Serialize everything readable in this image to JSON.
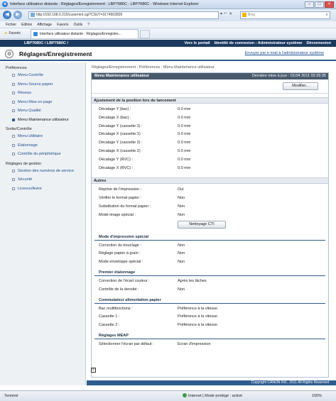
{
  "browser": {
    "window_title": "Interface utilisateur distante : Réglages/Enregistrement : LBP7680C : LBP7680C - Windows Internet Explorer",
    "address": "http://192.168.0.215/cusermnt.cgi?CSUT=3174502826",
    "search_placeholder": "Bing",
    "menu": [
      "Fichier",
      "Edition",
      "Affichage",
      "Favoris",
      "Outils",
      "?"
    ],
    "favorites_label": "Favoris",
    "tab_label": "Interface utilisateur distante : Réglages/Enregistre...",
    "status_left": "Terminé",
    "status_zone": "Internet | Mode protégé : activé",
    "zoom": "100%"
  },
  "app": {
    "model": "LBP7680C / LBP7680C /",
    "top_links": [
      "Vers le portail",
      "Identité de connexion : Administrateur système",
      "Déconnexion"
    ],
    "page_title": "Réglages/Enregistrement",
    "mail_link": "Envoyer par e-mail à l'administrateur système"
  },
  "sidebar": {
    "sections": [
      {
        "title": "Préférences",
        "items": [
          {
            "label": "Menu Contrôle",
            "active": false
          },
          {
            "label": "Menu Source papier",
            "active": false
          },
          {
            "label": "Réseau",
            "active": false
          },
          {
            "label": "Menu Mise en page",
            "active": false
          },
          {
            "label": "Menu Qualité",
            "active": false
          },
          {
            "label": "Menu Maintenance utilisateur",
            "active": true
          }
        ]
      },
      {
        "title": "Sortie/Contrôle",
        "items": [
          {
            "label": "Menu Utilitaire",
            "active": false
          },
          {
            "label": "Etalonnage",
            "active": false
          },
          {
            "label": "Contrôle du périphérique",
            "active": false
          }
        ]
      },
      {
        "title": "Réglages de gestion",
        "items": [
          {
            "label": "Gestion des numéros de service",
            "active": false
          },
          {
            "label": "Sécurité",
            "active": false
          },
          {
            "label": "Licence/Autre",
            "active": false
          }
        ]
      }
    ]
  },
  "main": {
    "breadcrumb": "Réglages/Enregistrement : Préférences : Menu Maintenance utilisateur",
    "panel_title": "Menu Maintenance utilisateur",
    "last_update": "Dernière mise à jour : 01/04 2011 02:29:35",
    "modify_button": "Modifier...",
    "group1": {
      "title": "Ajustement de la position lors du lancement",
      "rows": [
        {
          "label": "Décalage Y (bac) :",
          "value": "0.0 mm"
        },
        {
          "label": "Décalage X (bac) :",
          "value": "0.0 mm"
        },
        {
          "label": "Décalage Y (cassette 1) :",
          "value": "0.0 mm"
        },
        {
          "label": "Décalage X (cassette 1) :",
          "value": "0.0 mm"
        },
        {
          "label": "Décalage Y (cassette 2) :",
          "value": "0.0 mm"
        },
        {
          "label": "Décalage X (cassette 2) :",
          "value": "0.0 mm"
        },
        {
          "label": "Décalage Y (RVC) :",
          "value": "0.0 mm"
        },
        {
          "label": "Décalage X (RVC) :",
          "value": "0.0 mm"
        }
      ]
    },
    "group2": {
      "title": "Autres",
      "rows": [
        {
          "label": "Reprise de l'impression :",
          "value": "Oui"
        },
        {
          "label": "Vérifier le format papier :",
          "value": "Non"
        },
        {
          "label": "Substitution du format papier :",
          "value": "Non"
        },
        {
          "label": "Mode image spécial :",
          "value": "Non"
        }
      ],
      "cti_button": "Nettoyage CTI",
      "subsections": [
        {
          "title": "Mode d'impression spécial",
          "rows": [
            {
              "label": "Correction du bouclage :",
              "value": "Non"
            },
            {
              "label": "Réglage papier à grain :",
              "value": "Non"
            },
            {
              "label": "Mode enveloppe spécial :",
              "value": "Non"
            }
          ]
        },
        {
          "title": "Premier étalonnage",
          "rows": [
            {
              "label": "Correction de l'écart couleur :",
              "value": "Après les tâches"
            },
            {
              "label": "Contrôle de la densité :",
              "value": "Non"
            }
          ]
        },
        {
          "title": "Commutateur alimentation papier",
          "rows": [
            {
              "label": "Bac multifonctions :",
              "value": "Préférence à la vitesse"
            },
            {
              "label": "Cassette 1 :",
              "value": "Préférence à la vitesse"
            },
            {
              "label": "Cassette 2 :",
              "value": "Préférence à la vitesse"
            }
          ]
        },
        {
          "title": "Réglages MEAP",
          "rows": [
            {
              "label": "Sélectionner l'écran par défaut :",
              "value": "Ecran d'impression"
            }
          ]
        }
      ]
    },
    "copyright": "Copyright CANON INC. 2011 All Rights Reserved"
  }
}
